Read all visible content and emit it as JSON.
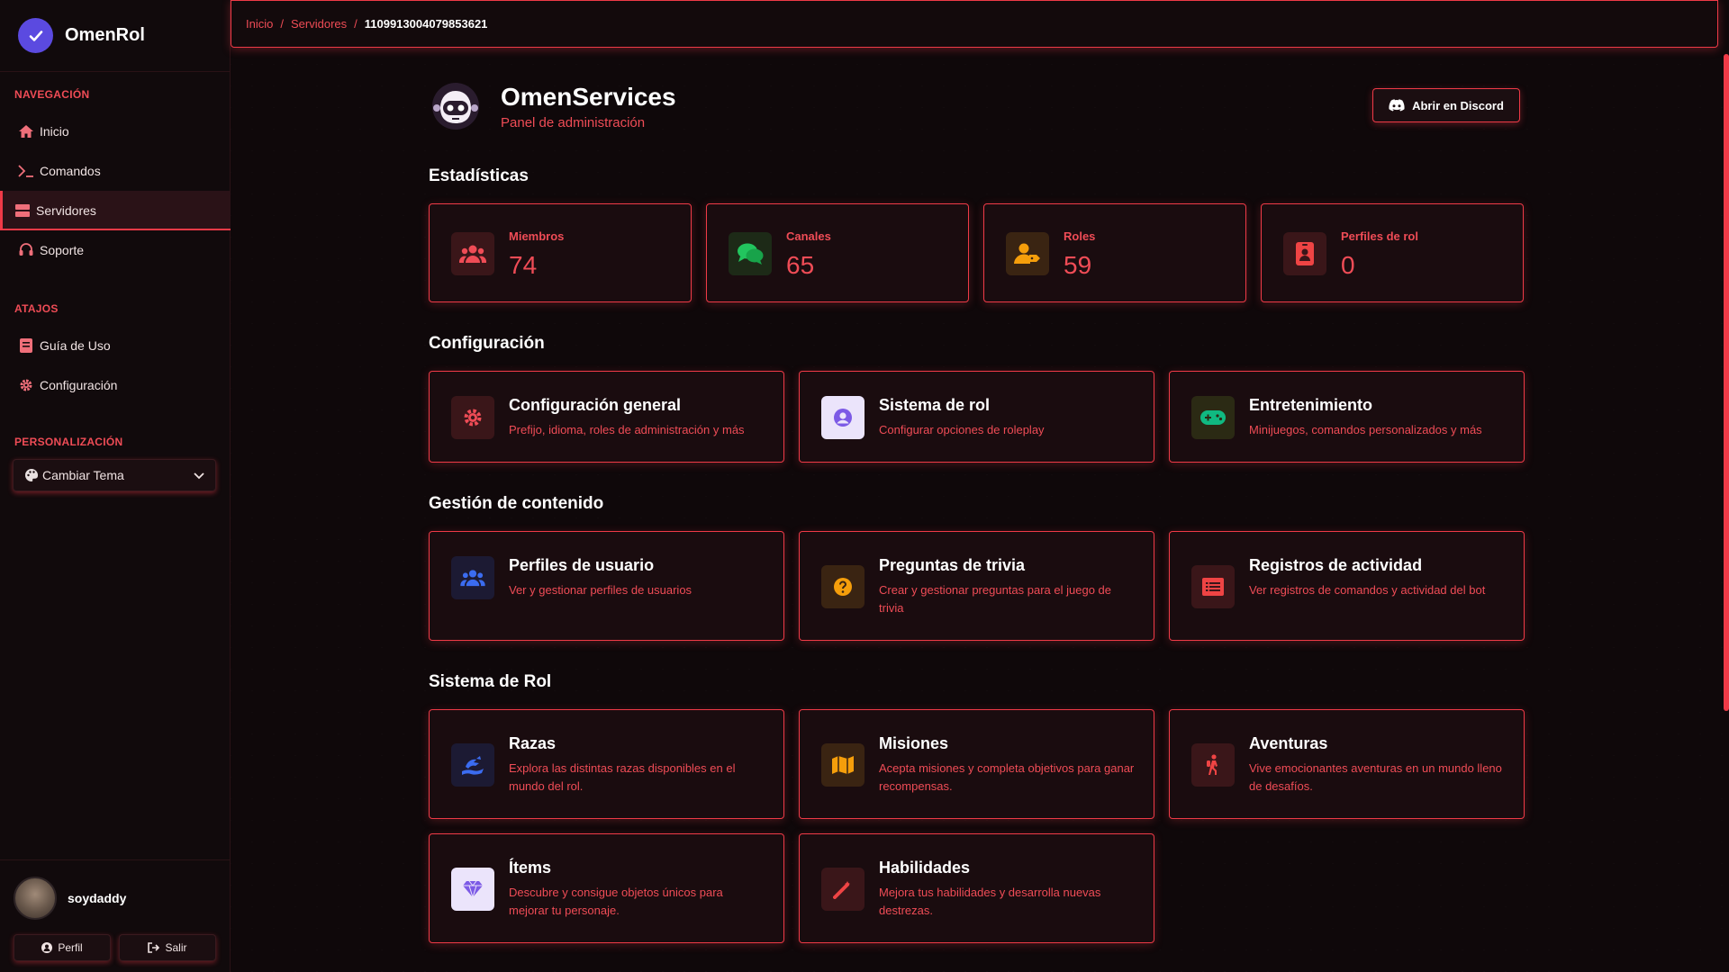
{
  "app": {
    "name": "OmenRol"
  },
  "sidebar": {
    "nav_label": "NAVEGACIÓN",
    "nav": [
      {
        "label": "Inicio",
        "icon": "home-icon"
      },
      {
        "label": "Comandos",
        "icon": "terminal-icon"
      },
      {
        "label": "Servidores",
        "icon": "server-icon",
        "active": true
      },
      {
        "label": "Soporte",
        "icon": "headset-icon"
      }
    ],
    "shortcuts_label": "ATAJOS",
    "shortcuts": [
      {
        "label": "Guía de Uso",
        "icon": "book-icon"
      },
      {
        "label": "Configuración",
        "icon": "gear-icon"
      }
    ],
    "personalization_label": "PERSONALIZACIÓN",
    "theme_select": "Cambiar Tema",
    "user": {
      "name": "soydaddy",
      "profile_label": "Perfil",
      "logout_label": "Salir"
    }
  },
  "breadcrumb": {
    "items": [
      "Inicio",
      "Servidores"
    ],
    "current": "1109913004079853621"
  },
  "header": {
    "title": "OmenServices",
    "subtitle": "Panel de administración",
    "discord_button": "Abrir en Discord"
  },
  "stats": {
    "title": "Estadísticas",
    "items": [
      {
        "label": "Miembros",
        "value": "74",
        "icon": "users-icon",
        "color": "#ef4c56"
      },
      {
        "label": "Canales",
        "value": "65",
        "icon": "chat-icon",
        "color": "#22c55e"
      },
      {
        "label": "Roles",
        "value": "59",
        "icon": "user-tag-icon",
        "color": "#f59e0b"
      },
      {
        "label": "Perfiles de rol",
        "value": "0",
        "icon": "id-card-icon",
        "color": "#ef4444"
      }
    ]
  },
  "config": {
    "title": "Configuración",
    "items": [
      {
        "title": "Configuración general",
        "desc": "Prefijo, idioma, roles de administración y más",
        "icon": "gear-icon"
      },
      {
        "title": "Sistema de rol",
        "desc": "Configurar opciones de roleplay",
        "icon": "user-circle-icon"
      },
      {
        "title": "Entretenimiento",
        "desc": "Minijuegos, comandos personalizados y más",
        "icon": "gamepad-icon"
      }
    ]
  },
  "content": {
    "title": "Gestión de contenido",
    "items": [
      {
        "title": "Perfiles de usuario",
        "desc": "Ver y gestionar perfiles de usuarios",
        "icon": "users-icon"
      },
      {
        "title": "Preguntas de trivia",
        "desc": "Crear y gestionar preguntas para el juego de trivia",
        "icon": "question-icon"
      },
      {
        "title": "Registros de actividad",
        "desc": "Ver registros de comandos y actividad del bot",
        "icon": "list-icon"
      }
    ]
  },
  "roleplay": {
    "title": "Sistema de Rol",
    "items": [
      {
        "title": "Razas",
        "desc": "Explora las distintas razas disponibles en el mundo del rol.",
        "icon": "dragon-icon"
      },
      {
        "title": "Misiones",
        "desc": "Acepta misiones y completa objetivos para ganar recompensas.",
        "icon": "map-icon"
      },
      {
        "title": "Aventuras",
        "desc": "Vive emocionantes aventuras en un mundo lleno de desafíos.",
        "icon": "hiker-icon"
      },
      {
        "title": "Ítems",
        "desc": "Descubre y consigue objetos únicos para mejorar tu personaje.",
        "icon": "gem-icon"
      },
      {
        "title": "Habilidades",
        "desc": "Mejora tus habilidades y desarrolla nuevas destrezas.",
        "icon": "wand-icon"
      }
    ]
  }
}
